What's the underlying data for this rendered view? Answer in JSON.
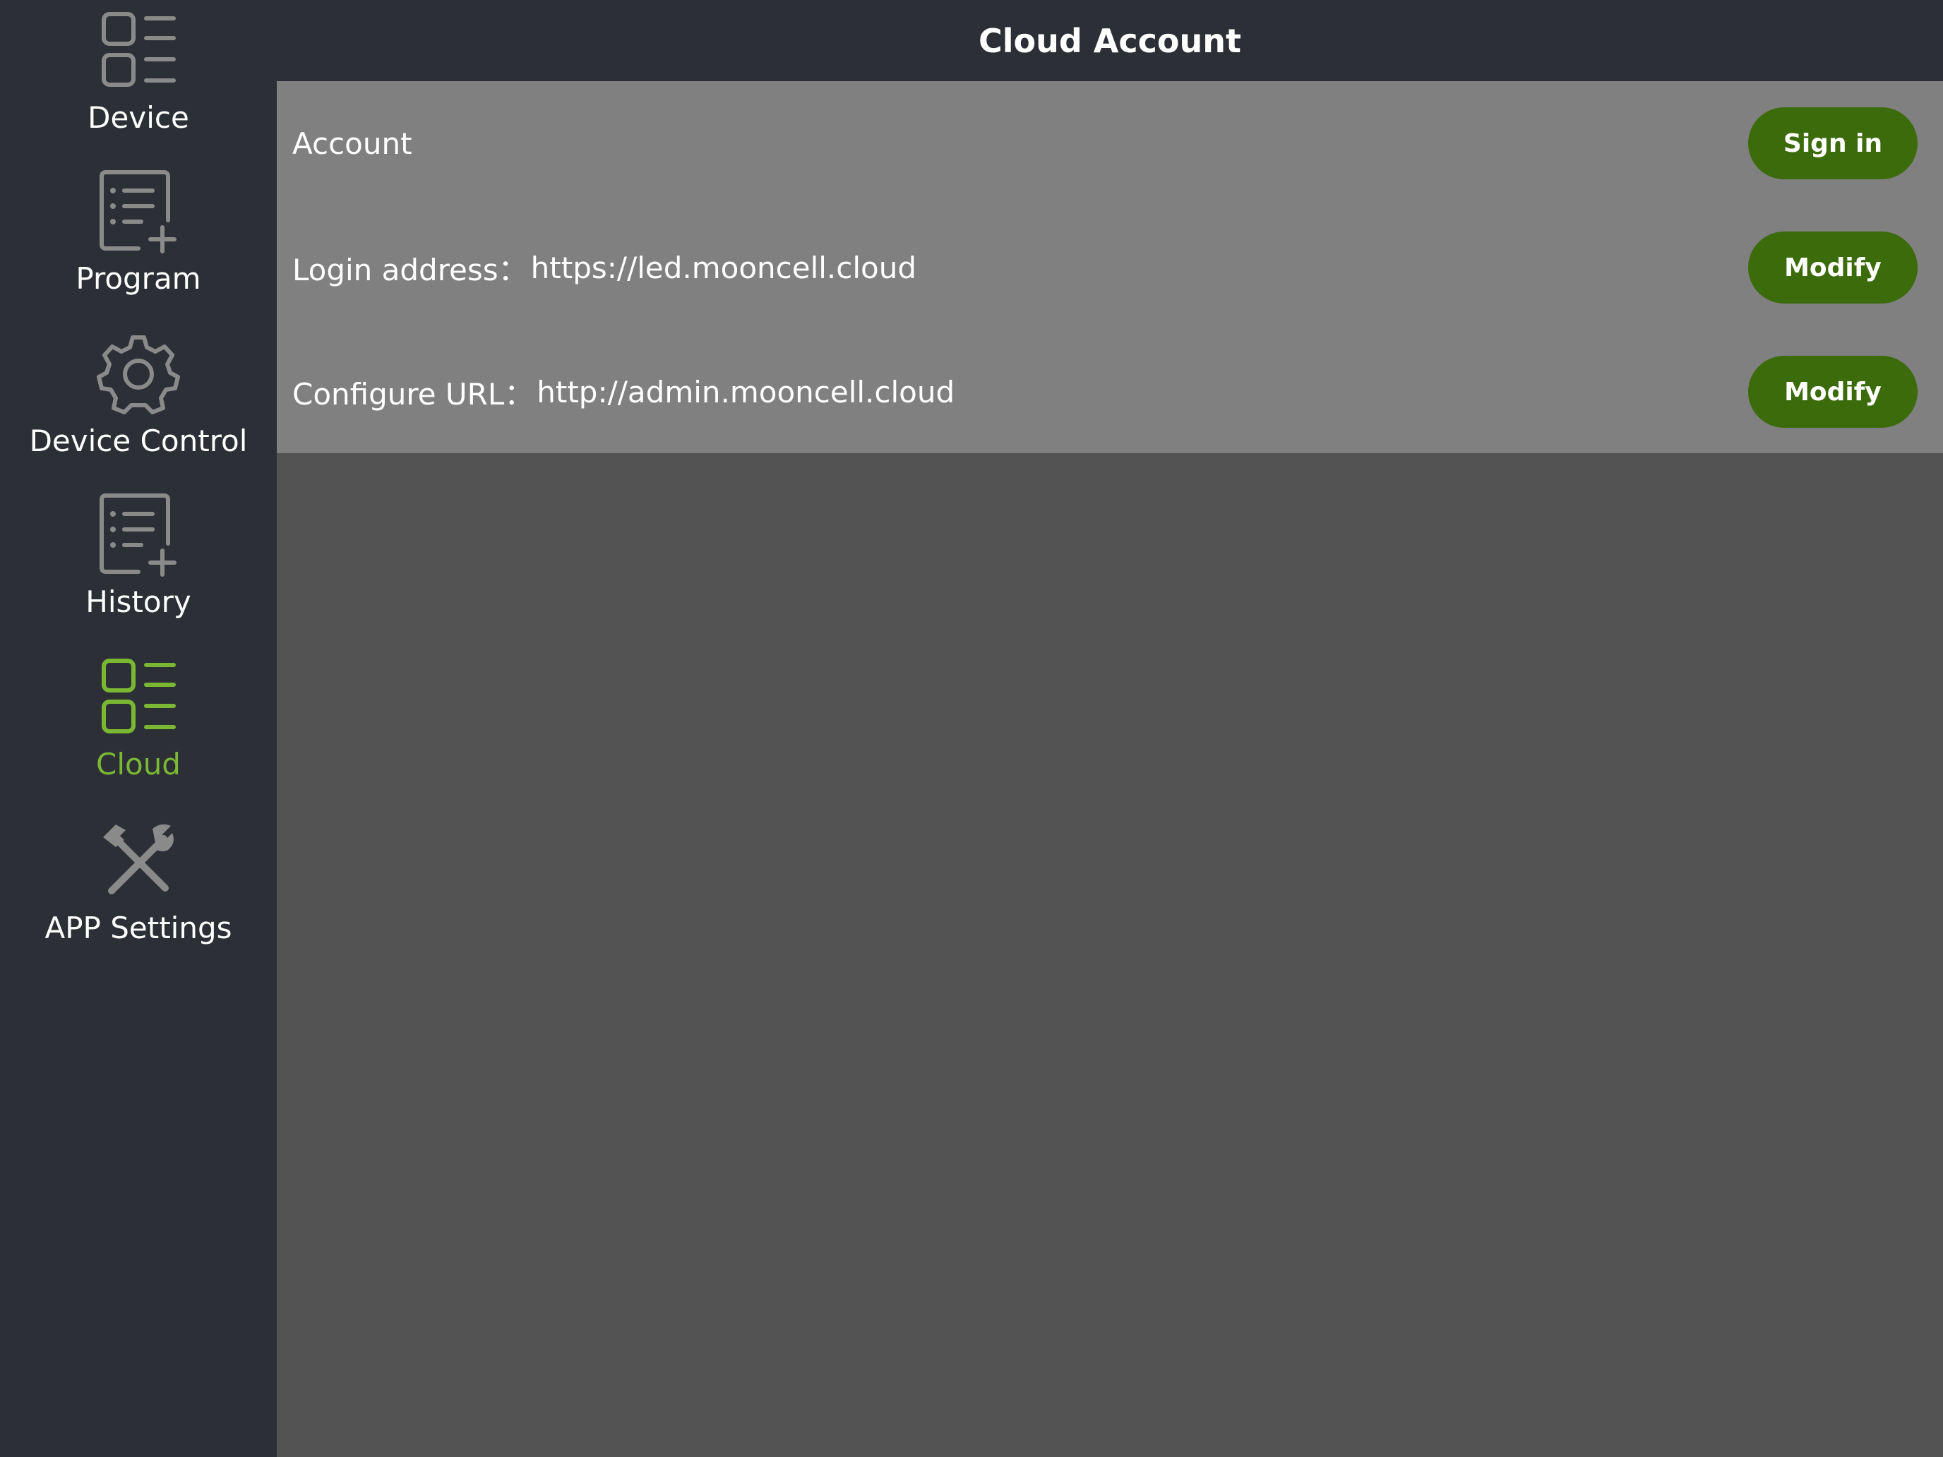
{
  "sidebar": {
    "items": [
      {
        "label": "Device",
        "icon": "list-icon"
      },
      {
        "label": "Program",
        "icon": "document-add-icon"
      },
      {
        "label": "Device Control",
        "icon": "gear-icon"
      },
      {
        "label": "History",
        "icon": "document-add-icon"
      },
      {
        "label": "Cloud",
        "icon": "list-icon",
        "active": true
      },
      {
        "label": "APP Settings",
        "icon": "tools-icon"
      }
    ]
  },
  "header": {
    "title": "Cloud Account"
  },
  "rows": [
    {
      "label": "Account",
      "value": "",
      "button": "Sign in"
    },
    {
      "label": "Login address：",
      "value": "https://led.mooncell.cloud",
      "button": "Modify"
    },
    {
      "label": "Configure URL：",
      "value": "http://admin.mooncell.cloud",
      "button": "Modify"
    }
  ],
  "colors": {
    "sidebar_bg": "#2c2f36",
    "panel_bg": "#808080",
    "content_bg": "#535353",
    "accent": "#7ab833",
    "button_bg": "#3b6b0a",
    "icon_inactive": "#8a8a8a"
  }
}
